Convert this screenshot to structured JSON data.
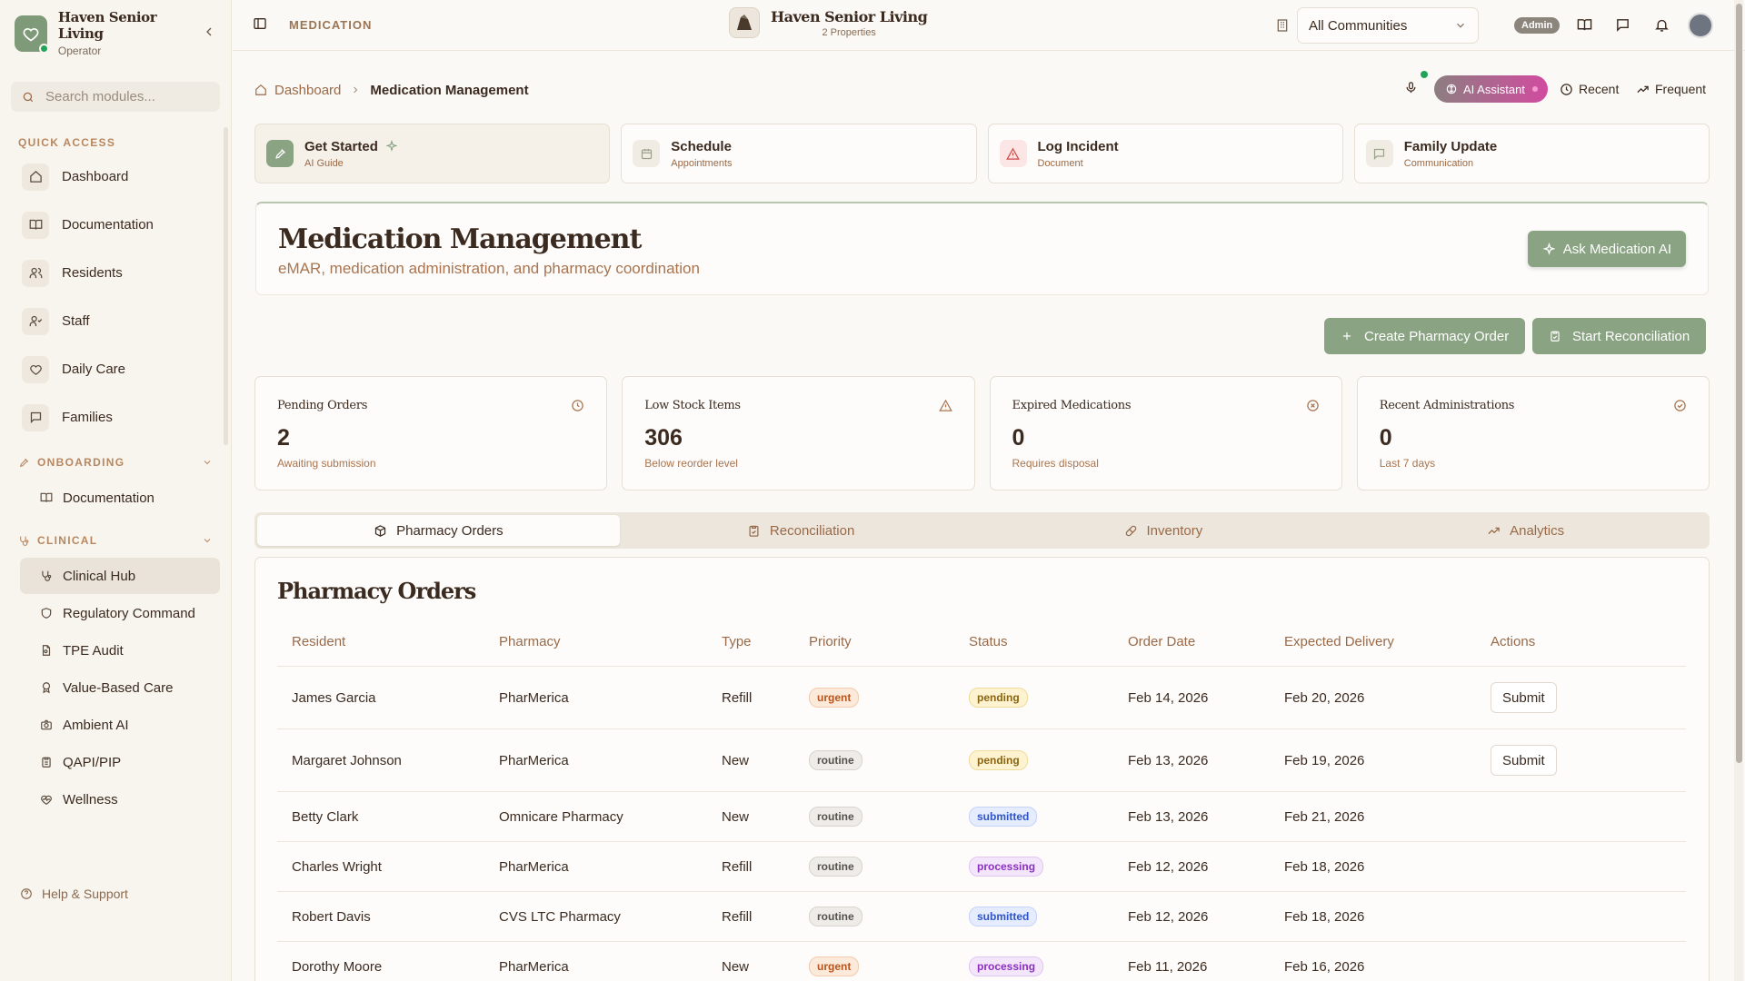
{
  "sidebar": {
    "brand_name": "Haven Senior Living",
    "brand_role": "Operator",
    "search_placeholder": "Search modules...",
    "quick_access_label": "QUICK ACCESS",
    "quick_access": [
      {
        "label": "Dashboard",
        "icon": "home-icon"
      },
      {
        "label": "Documentation",
        "icon": "book-icon"
      },
      {
        "label": "Residents",
        "icon": "users-icon"
      },
      {
        "label": "Staff",
        "icon": "user-check-icon"
      },
      {
        "label": "Daily Care",
        "icon": "heart-icon"
      },
      {
        "label": "Families",
        "icon": "message-icon"
      }
    ],
    "onboarding_label": "ONBOARDING",
    "onboarding_items": [
      {
        "label": "Documentation"
      }
    ],
    "clinical_label": "CLINICAL",
    "clinical_items": [
      {
        "label": "Clinical Hub"
      },
      {
        "label": "Regulatory Command"
      },
      {
        "label": "TPE Audit"
      },
      {
        "label": "Value-Based Care"
      },
      {
        "label": "Ambient AI"
      },
      {
        "label": "QAPI/PIP"
      },
      {
        "label": "Wellness"
      }
    ],
    "help_label": "Help & Support"
  },
  "topbar": {
    "module_label": "MEDICATION",
    "center_brand": "Haven Senior Living",
    "center_sub": "2 Properties",
    "community_select": "All Communities",
    "admin_badge": "Admin"
  },
  "breadcrumb": {
    "home": "Dashboard",
    "current": "Medication Management"
  },
  "assistant": {
    "ai_label": "AI Assistant",
    "recent_label": "Recent",
    "frequent_label": "Frequent"
  },
  "quick_cards": [
    {
      "title": "Get Started",
      "sub": "AI Guide"
    },
    {
      "title": "Schedule",
      "sub": "Appointments"
    },
    {
      "title": "Log Incident",
      "sub": "Document"
    },
    {
      "title": "Family Update",
      "sub": "Communication"
    }
  ],
  "hero": {
    "title": "Medication Management",
    "subtitle": "eMAR, medication administration, and pharmacy coordination",
    "ask_button": "Ask Medication AI"
  },
  "actions": {
    "create_order": "Create Pharmacy Order",
    "start_reconciliation": "Start Reconciliation"
  },
  "stats": [
    {
      "label": "Pending Orders",
      "value": "2",
      "sub": "Awaiting submission",
      "icon": "clock-icon"
    },
    {
      "label": "Low Stock Items",
      "value": "306",
      "sub": "Below reorder level",
      "icon": "warning-icon"
    },
    {
      "label": "Expired Medications",
      "value": "0",
      "sub": "Requires disposal",
      "icon": "x-circle-icon"
    },
    {
      "label": "Recent Administrations",
      "value": "0",
      "sub": "Last 7 days",
      "icon": "check-circle-icon"
    }
  ],
  "tabs": [
    {
      "label": "Pharmacy Orders",
      "icon": "package-icon"
    },
    {
      "label": "Reconciliation",
      "icon": "clipboard-icon"
    },
    {
      "label": "Inventory",
      "icon": "pill-icon"
    },
    {
      "label": "Analytics",
      "icon": "trend-icon"
    }
  ],
  "orders": {
    "title": "Pharmacy Orders",
    "columns": [
      "Resident",
      "Pharmacy",
      "Type",
      "Priority",
      "Status",
      "Order Date",
      "Expected Delivery",
      "Actions"
    ],
    "rows": [
      {
        "resident": "James Garcia",
        "pharmacy": "PharMerica",
        "type": "Refill",
        "priority": "urgent",
        "status": "pending",
        "order_date": "Feb 14, 2026",
        "delivery": "Feb 20, 2026",
        "action": "Submit"
      },
      {
        "resident": "Margaret Johnson",
        "pharmacy": "PharMerica",
        "type": "New",
        "priority": "routine",
        "status": "pending",
        "order_date": "Feb 13, 2026",
        "delivery": "Feb 19, 2026",
        "action": "Submit"
      },
      {
        "resident": "Betty Clark",
        "pharmacy": "Omnicare Pharmacy",
        "type": "New",
        "priority": "routine",
        "status": "submitted",
        "order_date": "Feb 13, 2026",
        "delivery": "Feb 21, 2026",
        "action": ""
      },
      {
        "resident": "Charles Wright",
        "pharmacy": "PharMerica",
        "type": "Refill",
        "priority": "routine",
        "status": "processing",
        "order_date": "Feb 12, 2026",
        "delivery": "Feb 18, 2026",
        "action": ""
      },
      {
        "resident": "Robert Davis",
        "pharmacy": "CVS LTC Pharmacy",
        "type": "Refill",
        "priority": "routine",
        "status": "submitted",
        "order_date": "Feb 12, 2026",
        "delivery": "Feb 18, 2026",
        "action": ""
      },
      {
        "resident": "Dorothy Moore",
        "pharmacy": "PharMerica",
        "type": "New",
        "priority": "urgent",
        "status": "processing",
        "order_date": "Feb 11, 2026",
        "delivery": "Feb 16, 2026",
        "action": ""
      }
    ]
  },
  "colors": {
    "accent_green": "#8aa383",
    "brown_text": "#9a6a48",
    "ai_gradient_end": "#d24ba0"
  }
}
